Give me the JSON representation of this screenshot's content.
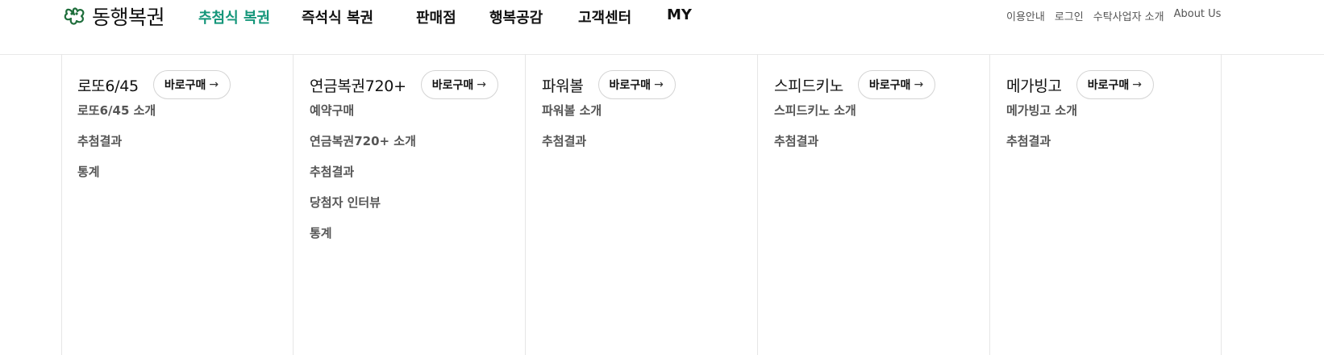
{
  "brand": {
    "name": "동행복권",
    "primary_color": "#14967a"
  },
  "gnb": [
    {
      "label": "추첨식 복권",
      "active": true
    },
    {
      "label": "즉석식 복권"
    },
    {
      "label": "판매점"
    },
    {
      "label": "행복공감"
    },
    {
      "label": "고객센터"
    },
    {
      "label": "MY"
    }
  ],
  "util": [
    "이용안내",
    "로그인",
    "수탁사업자 소개",
    "About Us"
  ],
  "buy_label": "바로구매",
  "buy_icon": "arrow-right-icon",
  "columns": [
    {
      "title": "로또6/45",
      "items": [
        "로또6/45 소개",
        "추첨결과",
        "통계"
      ]
    },
    {
      "title": "연금복권720+",
      "items": [
        "예약구매",
        "연금복권720+ 소개",
        "추첨결과",
        "당첨자 인터뷰",
        "통계"
      ]
    },
    {
      "title": "파워볼",
      "items": [
        "파워볼 소개",
        "추첨결과"
      ]
    },
    {
      "title": "스피드키노",
      "items": [
        "스피드키노 소개",
        "추첨결과"
      ]
    },
    {
      "title": "메가빙고",
      "items": [
        "메가빙고 소개",
        "추첨결과"
      ]
    }
  ]
}
